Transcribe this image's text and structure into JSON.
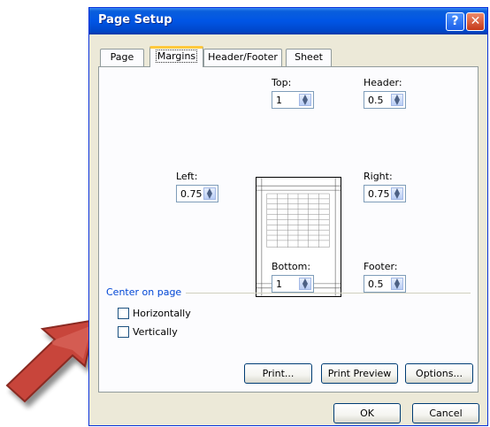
{
  "window": {
    "title": "Page Setup",
    "help_glyph": "?",
    "close_glyph": "✕"
  },
  "tabs": [
    {
      "label": "Page",
      "active": false
    },
    {
      "label": "Margins",
      "active": true
    },
    {
      "label": "Header/Footer",
      "active": false
    },
    {
      "label": "Sheet",
      "active": false
    }
  ],
  "margins": {
    "top": {
      "label": "Top:",
      "value": "1"
    },
    "header": {
      "label": "Header:",
      "value": "0.5"
    },
    "left": {
      "label": "Left:",
      "value": "0.75"
    },
    "right": {
      "label": "Right:",
      "value": "0.75"
    },
    "bottom": {
      "label": "Bottom:",
      "value": "1"
    },
    "footer": {
      "label": "Footer:",
      "value": "0.5"
    }
  },
  "center_on_page": {
    "label": "Center on page",
    "horizontally": {
      "label": "Horizontally",
      "checked": false
    },
    "vertically": {
      "label": "Vertically",
      "checked": false
    }
  },
  "buttons": {
    "print": "Print...",
    "print_preview": "Print Preview",
    "options": "Options...",
    "ok": "OK",
    "cancel": "Cancel"
  },
  "colors": {
    "titlebar": "#0055e5",
    "dialog_bg": "#ece9d8",
    "group_label": "#0046d5",
    "arrow": "#c8443a"
  },
  "icons": {
    "spin": "spin-updown-icon",
    "arrow": "red-pointer-arrow-icon"
  }
}
